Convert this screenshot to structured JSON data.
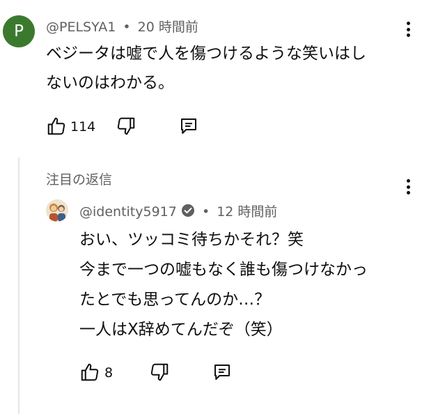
{
  "comment": {
    "avatar_letter": "P",
    "author": "@PELSYA1",
    "separator": "•",
    "time": "20 時間前",
    "text_line1": "ベジータは嘘で人を傷つけるような笑いはし",
    "text_line2": "ないのはわかる。",
    "like_count": "114"
  },
  "pinned_label": "注目の返信",
  "reply": {
    "author": "@identity5917",
    "separator": "•",
    "time": "12 時間前",
    "lines": [
      "おい、ツッコミ待ちかそれ？笑",
      "今まで一つの嘘もなく誰も傷つけなかっ",
      "たとでも思ってんのか…？",
      "一人はX辞めてんだぞ（笑）"
    ],
    "like_count": "8"
  },
  "icons": {
    "like": "thumbs-up-icon",
    "dislike": "thumbs-down-icon",
    "reply": "reply-icon",
    "more": "more-vert-icon",
    "verified": "verified-check-icon"
  }
}
